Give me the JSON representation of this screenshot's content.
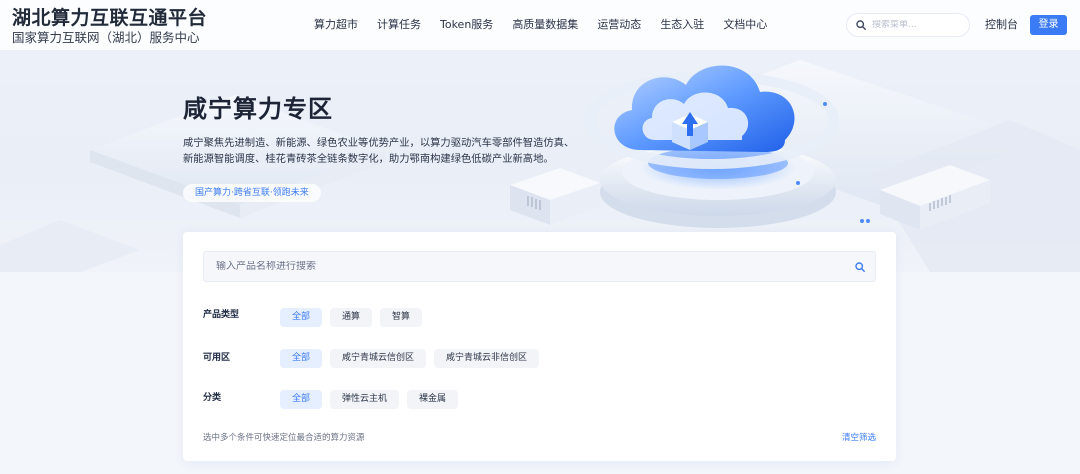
{
  "brand": {
    "title": "湖北算力互联互通平台",
    "subtitle": "国家算力互联网（湖北）服务中心"
  },
  "nav": {
    "items": [
      {
        "label": "算力超市"
      },
      {
        "label": "计算任务"
      },
      {
        "label": "Token服务"
      },
      {
        "label": "高质量数据集"
      },
      {
        "label": "运营动态"
      },
      {
        "label": "生态入驻"
      },
      {
        "label": "文档中心"
      }
    ]
  },
  "header": {
    "search_placeholder": "搜索菜单...",
    "console_label": "控制台",
    "login_label": "登录"
  },
  "hero": {
    "title": "咸宁算力专区",
    "description": "咸宁聚焦先进制造、新能源、绿色农业等优势产业，以算力驱动汽车零部件智造仿真、新能源智能调度、桂花青砖茶全链条数字化，助力鄂南构建绿色低碳产业新高地。",
    "tag": "国产算力·跨省互联·领跑未来"
  },
  "filter": {
    "search_placeholder": "输入产品名称进行搜索",
    "groups": [
      {
        "label": "产品类型",
        "options": [
          "全部",
          "通算",
          "智算"
        ],
        "selected": 0
      },
      {
        "label": "可用区",
        "options": [
          "全部",
          "咸宁青城云信创区",
          "咸宁青城云非信创区"
        ],
        "selected": 0
      },
      {
        "label": "分类",
        "options": [
          "全部",
          "弹性云主机",
          "裸金属"
        ],
        "selected": 0
      }
    ],
    "hint": "选中多个条件可快速定位最合适的算力资源",
    "clear_label": "清空筛选"
  },
  "colors": {
    "accent": "#3b7bf6",
    "chip_active_bg": "#e6efff",
    "chip_bg": "#f2f4f7"
  }
}
